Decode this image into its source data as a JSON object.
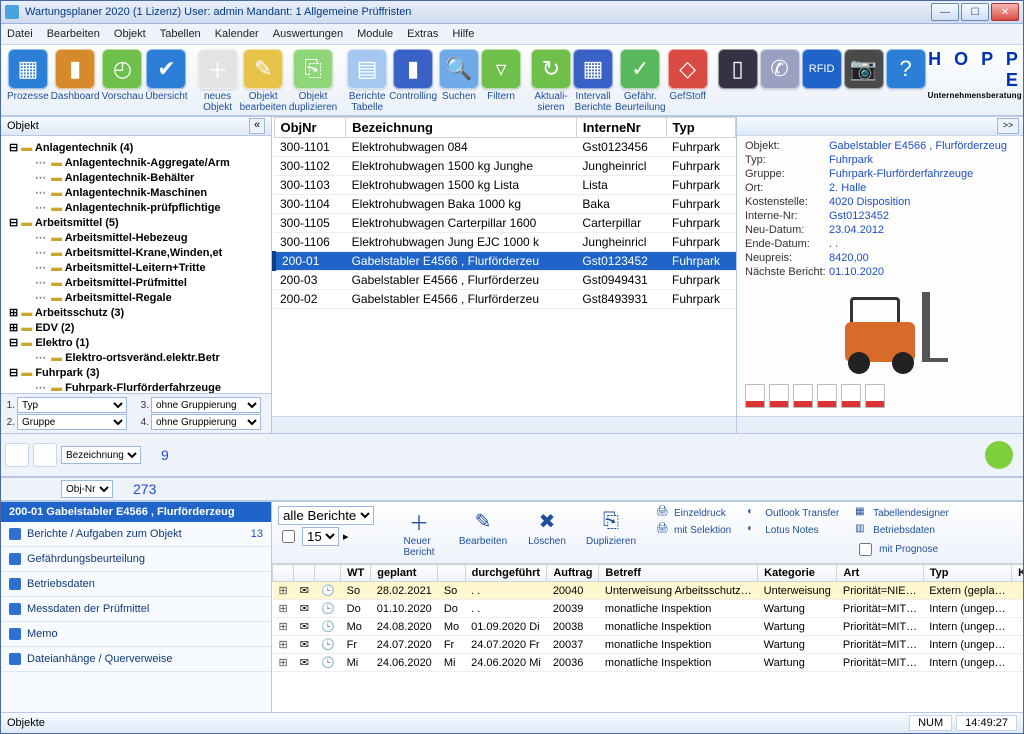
{
  "title": "Wartungsplaner 2020  (1 Lizenz)    User: admin    Mandant: 1 Allgemeine Prüffristen",
  "menu": [
    "Datei",
    "Bearbeiten",
    "Objekt",
    "Tabellen",
    "Kalender",
    "Auswertungen",
    "Module",
    "Extras",
    "Hilfe"
  ],
  "toolbar": [
    {
      "label": "Prozesse",
      "color": "#2b7fd6",
      "glyph": "▦"
    },
    {
      "label": "Dashboard",
      "color": "#d68a2b",
      "glyph": "▮"
    },
    {
      "label": "Vorschau",
      "color": "#6fbf4b",
      "glyph": "◴"
    },
    {
      "label": "Übersicht",
      "color": "#2b7fd6",
      "glyph": "✔"
    },
    {
      "label": "neues\nObjekt",
      "color": "#e3e3e3",
      "glyph": "＋"
    },
    {
      "label": "Objekt\nbearbeiten",
      "color": "#e8c34a",
      "glyph": "✎"
    },
    {
      "label": "Objekt\nduplizieren",
      "color": "#8fd67a",
      "glyph": "⎘"
    },
    {
      "label": "Berichte\nTabelle",
      "color": "#a6c7ef",
      "glyph": "▤"
    },
    {
      "label": "Controlling",
      "color": "#3a62c6",
      "glyph": "▮"
    },
    {
      "label": "Suchen",
      "color": "#6fa9e8",
      "glyph": "🔍"
    },
    {
      "label": "Filtern",
      "color": "#6fbf4b",
      "glyph": "▿"
    },
    {
      "label": "Aktuali-\nsieren",
      "color": "#6fbf4b",
      "glyph": "↻"
    },
    {
      "label": "Intervall\nBerichte",
      "color": "#3a62c6",
      "glyph": "▦"
    },
    {
      "label": "Gefähr.\nBeurteilung",
      "color": "#59b85e",
      "glyph": "✓"
    },
    {
      "label": "GefStoff",
      "color": "#d94b42",
      "glyph": "◇"
    },
    {
      "label": "",
      "color": "#334",
      "glyph": "▯"
    },
    {
      "label": "",
      "color": "#9aa0c2",
      "glyph": "✆"
    },
    {
      "label": "",
      "color": "#1f64c8",
      "glyph": "RFID"
    },
    {
      "label": "",
      "color": "#4a4a4a",
      "glyph": "📷"
    },
    {
      "label": "",
      "color": "#2b7fd6",
      "glyph": "?"
    }
  ],
  "logo": {
    "big": "H O P P E",
    "small": "Unternehmensberatung"
  },
  "treeHeader": "Objekt",
  "tree": [
    {
      "l": 1,
      "b": true,
      "t": "Anlagentechnik  (4)",
      "open": true
    },
    {
      "l": 2,
      "b": true,
      "t": "Anlagentechnik-Aggregate/Arm"
    },
    {
      "l": 2,
      "b": true,
      "t": "Anlagentechnik-Behälter"
    },
    {
      "l": 2,
      "b": true,
      "t": "Anlagentechnik-Maschinen"
    },
    {
      "l": 2,
      "b": true,
      "t": "Anlagentechnik-prüfpflichtige"
    },
    {
      "l": 1,
      "b": true,
      "t": "Arbeitsmittel  (5)",
      "open": true
    },
    {
      "l": 2,
      "b": true,
      "t": "Arbeitsmittel-Hebezeug"
    },
    {
      "l": 2,
      "b": true,
      "t": "Arbeitsmittel-Krane,Winden,et"
    },
    {
      "l": 2,
      "b": true,
      "t": "Arbeitsmittel-Leitern+Tritte"
    },
    {
      "l": 2,
      "b": true,
      "t": "Arbeitsmittel-Prüfmittel"
    },
    {
      "l": 2,
      "b": true,
      "t": "Arbeitsmittel-Regale"
    },
    {
      "l": 1,
      "b": true,
      "t": "Arbeitsschutz  (3)"
    },
    {
      "l": 1,
      "b": true,
      "t": "EDV  (2)"
    },
    {
      "l": 1,
      "b": true,
      "t": "Elektro  (1)",
      "open": true
    },
    {
      "l": 2,
      "b": true,
      "t": "Elektro-ortsveränd.elektr.Betr"
    },
    {
      "l": 1,
      "b": true,
      "t": "Fuhrpark  (3)",
      "open": true
    },
    {
      "l": 2,
      "b": true,
      "t": "Fuhrpark-Flurförderfahrzeuge"
    }
  ],
  "treeFooter": {
    "r1a": "Typ",
    "r1b": "ohne Gruppierung",
    "n1": "1.",
    "n3": "3.",
    "r2a": "Gruppe",
    "r2b": "ohne Gruppierung",
    "n2": "2.",
    "n4": "4."
  },
  "gridCols": [
    "ObjNr",
    "Bezeichnung",
    "InterneNr",
    "Typ"
  ],
  "gridRows": [
    {
      "c": [
        "300-1101",
        "Elektrohubwagen 084",
        "Gst0123456",
        "Fuhrpark"
      ]
    },
    {
      "c": [
        "300-1102",
        "Elektrohubwagen 1500 kg  Junghe",
        "Jungheinricl",
        "Fuhrpark"
      ]
    },
    {
      "c": [
        "300-1103",
        "Elektrohubwagen 1500 kg Lista",
        "Lista",
        "Fuhrpark"
      ]
    },
    {
      "c": [
        "300-1104",
        "Elektrohubwagen Baka 1000 kg",
        "Baka",
        "Fuhrpark"
      ]
    },
    {
      "c": [
        "300-1105",
        "Elektrohubwagen Carterpillar 1600",
        "Carterpillar",
        "Fuhrpark"
      ]
    },
    {
      "c": [
        "300-1106",
        "Elektrohubwagen Jung EJC 1000 k",
        "Jungheinricl",
        "Fuhrpark"
      ]
    },
    {
      "c": [
        "200-01",
        "Gabelstabler E4566 , Flurförderzeu",
        "Gst0123452",
        "Fuhrpark"
      ],
      "sel": true
    },
    {
      "c": [
        "200-03",
        "Gabelstabler E4566 , Flurförderzeu",
        "Gst0949431",
        "Fuhrpark"
      ]
    },
    {
      "c": [
        "200-02",
        "Gabelstabler E4566 , Flurförderzeu",
        "Gst8493931",
        "Fuhrpark"
      ]
    }
  ],
  "details": [
    {
      "k": "Objekt:",
      "v": "Gabelstabler E4566 , Flurförderzeug"
    },
    {
      "k": "Typ:",
      "v": "Fuhrpark"
    },
    {
      "k": "Gruppe:",
      "v": "Fuhrpark-Flurförderfahrzeuge"
    },
    {
      "k": "Ort:",
      "v": "2. Halle"
    },
    {
      "k": "Kostenstelle:",
      "v": "4020 Disposition"
    },
    {
      "k": "Interne-Nr:",
      "v": "Gst0123452"
    },
    {
      "k": "Neu-Datum:",
      "v": "23.04.2012"
    },
    {
      "k": "Ende-Datum:",
      "v": " .  ."
    },
    {
      "k": "Neupreis:",
      "v": "8420,00"
    },
    {
      "k": "Nächste Bericht:",
      "v": "01.10.2020"
    }
  ],
  "midstrip": {
    "sel1": "Bezeichnung",
    "sel2": "Obj-Nr",
    "count1": "9",
    "count2": "273"
  },
  "bottomLeft": {
    "title": "200-01 Gabelstabler E4566 , Flurförderzeug",
    "items": [
      {
        "t": "Berichte / Aufgaben zum Objekt",
        "cnt": "13"
      },
      {
        "t": "Gefährdungsbeurteilung"
      },
      {
        "t": "Betriebsdaten"
      },
      {
        "t": "Messdaten der Prüfmittel"
      },
      {
        "t": "Memo"
      },
      {
        "t": "Dateianhänge / Querverweise"
      }
    ]
  },
  "reportTools": {
    "filter": "alle Berichte",
    "pagesize": "15",
    "btns": [
      {
        "t": "Neuer\nBericht",
        "g": "＋"
      },
      {
        "t": "Bearbeiten",
        "g": "✎"
      },
      {
        "t": "Löschen",
        "g": "✖"
      },
      {
        "t": "Duplizieren",
        "g": "⎘"
      }
    ],
    "side1": [
      {
        "t": "Einzeldruck",
        "g": "🖨"
      },
      {
        "t": "mit Selektion",
        "g": "🖨"
      }
    ],
    "side2": [
      {
        "t": "Outlook Transfer",
        "g": "◐"
      },
      {
        "t": "Lotus Notes",
        "g": "◐"
      }
    ],
    "side3": [
      {
        "t": "Tabellendesigner",
        "g": "▦"
      },
      {
        "t": "Betriebsdaten",
        "g": "▥"
      },
      {
        "t": "mit Prognose",
        "checkbox": true
      }
    ]
  },
  "repCols": [
    "",
    "",
    "",
    "WT",
    "geplant",
    "",
    "durchgeführt",
    "Auftrag",
    "Betreff",
    "Kategorie",
    "Art",
    "Typ",
    "K"
  ],
  "repRows": [
    {
      "hl": true,
      "c": [
        "⊞",
        "✉",
        "🕒",
        "So",
        "28.02.2021",
        "So",
        ". .",
        "20040",
        "Unterweisung Arbeitsschutz…",
        "Unterweisung",
        "Priorität=NIE…",
        "Extern (gepla…",
        ""
      ]
    },
    {
      "c": [
        "⊞",
        "✉",
        "🕒",
        "Do",
        "01.10.2020",
        "Do",
        ". .",
        "20039",
        "monatliche Inspektion",
        "Wartung",
        "Priorität=MIT…",
        "Intern (ungep…",
        ""
      ]
    },
    {
      "c": [
        "⊞",
        "✉",
        "🕒",
        "Mo",
        "24.08.2020",
        "Mo",
        "01.09.2020  Di",
        "20038",
        "monatliche Inspektion",
        "Wartung",
        "Priorität=MIT…",
        "Intern (ungep…",
        ""
      ]
    },
    {
      "c": [
        "⊞",
        "✉",
        "🕒",
        "Fr",
        "24.07.2020",
        "Fr",
        "24.07.2020  Fr",
        "20037",
        "monatliche Inspektion",
        "Wartung",
        "Priorität=MIT…",
        "Intern (ungep…",
        ""
      ]
    },
    {
      "c": [
        "⊞",
        "✉",
        "🕒",
        "Mi",
        "24.06.2020",
        "Mi",
        "24.06.2020  Mi",
        "20036",
        "monatliche Inspektion",
        "Wartung",
        "Priorität=MIT…",
        "Intern (ungep…",
        ""
      ]
    }
  ],
  "status": {
    "left": "Objekte",
    "num": "NUM",
    "time": "14:49:27"
  }
}
